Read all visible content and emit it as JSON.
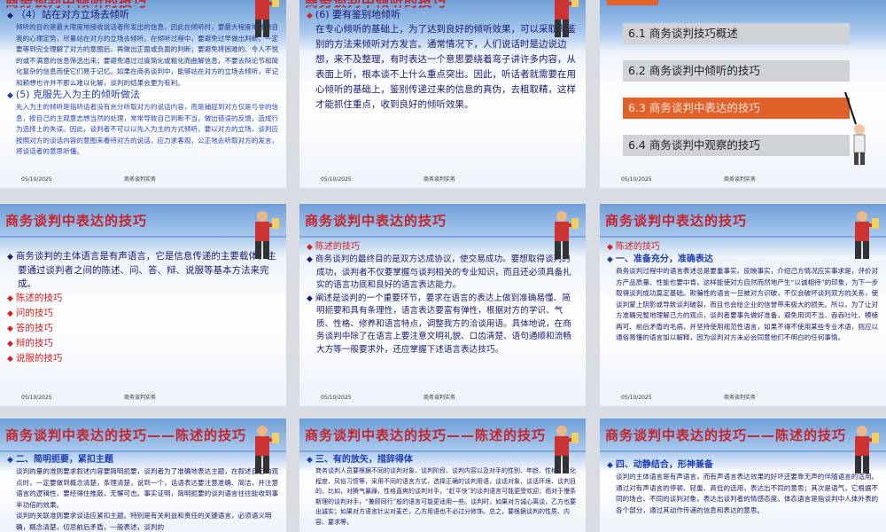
{
  "footer": {
    "date": "05/10/2025",
    "course": "商务谈判实务"
  },
  "slides": {
    "s1": {
      "title": "商务谈判中倾听的技巧",
      "h1": "（4）站在对方立场去倾听",
      "p1": "倾听的目的是最大限度地接收说话者所发出的信息，因此在倾听时，要最大程度地减除自我的心理定势，尽量站在对方的立场去倾听。在倾听过程中，要避免过早做出判断，一定要等到完全理解了对方的意图后，再做出正面或负面的判断；要避免将困难的、令人不悦的或不满意的信息筛选出来；要避免通过过度简化或粗化而曲解信息，不要去辩论节和简化复杂的信息而使它们易于记忆。如果在商务谈判中，能够站在对方的立场去倾听，牢记和赖想也许并不那么难以化解，谈判的结果会更为有利。",
      "h2": "(5) 克服先入为主的倾听做法",
      "p2": "先入为主的倾听是指听话者没有充分听取对方的说话内容，而是捕捉到对方仅是与非的信息，按自己的主观意志想当然的处理，常常导致自己判断不当，做出错误的反馈，造成行为选择上的失误。因此，谈判者不可以以先入为主的方式倾听，要以对方的立场，谈判应按照对方的谈话内容的意图来看待对方的说话，应力求客观，公正地去听取对方的发言，将谈话者的意思听懂。"
    },
    "s2": {
      "title": "商务谈判中倾听的技巧",
      "h1": "(6) 要有鉴别地倾听",
      "p1": "在专心倾听的基础上，为了达到良好的倾听效果，可以采取有鉴别的方法来倾听对方发言。通常情况下，人们说话时是边说边想，来不及整理，有时表达一个意思要绕着弯子讲许多内容，从表面上听，根本谈不上什么重点突出。因此，听话者就需要在用心倾听的基础上，鉴别传递过来的信息的真伪，去粗取精，这样才能抓住重点，收到良好的倾听效果。"
    },
    "s3": {
      "menu": [
        "6.1 商务谈判技巧概述",
        "6.2 商务谈判中倾听的技巧",
        "6.3 商务谈判中表达的技巧",
        "6.4 商务谈判中观察的技巧"
      ]
    },
    "s4": {
      "title": "商务谈判中表达的技巧",
      "p1": "商务谈判的主体语言是有声语言，它是信息传递的主要载体，主要通过谈判者之间的陈述、问、答、辩、说服等基本方法来完成。",
      "items": [
        "陈述的技巧",
        "问的技巧",
        "答的技巧",
        "辩的技巧",
        "说服的技巧"
      ]
    },
    "s5": {
      "title": "商务谈判中表达的技巧",
      "h0": "陈述的技巧",
      "p1": "商务谈判的最终目的是双方达成协议，使交易成功。要想取得谈判的成功，谈判者不仅要掌握与谈判相关的专业知识，而且还必须具备扎实的语言功底和良好的语言表达能力。",
      "p2": "阐述是谈判的一个重要环节，要求在语言的表达上做到准确易懂、简明扼要和具有条理性，语言表达要富有弹性，根据对方的学识、气质、性格、修养和语言特点，调整我方的洽谈用语。具体地说，在商务谈判中除了在语言上要注意文明礼貌、口齿清楚、语句通顺和流畅大方等一般要求外，还应掌握下述语言表达技巧。"
    },
    "s6": {
      "title": "商务谈判中表达的技巧",
      "h0": "陈述的技巧",
      "h1": "一、准备充分，准确表达",
      "p1": "商务谈判过程中的语言表述总是要重事实、反映事实，介绍己方情况应实事求是，评价对方产品质量、性能也要中肯，这样能使对方自然而然地产生“以诚相待”的印象，为下一步取得谈判成功奠定基础。欺骗性的语言一旦被对方识破，不仅会破坏谈判双方的关系，使谈判蒙上阴影或导致谈判破裂，而且也会给企业的信誉带来极大的损失。所以，为了让对方准确完整地理解己方的观点，谈判者要事先做好准备，避免用词不当、吞吞吐吐、模棱两可、前后矛盾的毛病，并坚持使用规范性语言，如果不得不使用某些专业术语，则应以通俗易懂的语言加以解释，因为谈判对方未必会同意他们不明白的任何事情。"
    },
    "s7": {
      "title": "商务谈判中表达的技巧——陈述的技巧",
      "h1": "二、简明扼要，紧扣主题",
      "p1": "谈判的量的准则要求叙述内容要简明扼要，谈判者为了准确地表达主题，在叙述自己的观点时，一定要做到概念清楚，条理清楚，说到一个，话语表达要注意准确、简洁，并注意语言的逻辑性，要经得住推敲，无懈可击。事实证明，简明扼要的谈判语言往往能收到事半功倍的效果。",
      "p2": "谈判的关联准则要求谈话应紧扣主题。特别是有关利益和责任的关键语言，必须语义明确，概念清楚，切忌前后矛盾，一般表述，谈判的"
    },
    "s8": {
      "title": "商务谈判中表达的技巧——陈述的技巧",
      "h1": "三、有的放矢，措辞得体",
      "p1": "商务谈判人员要根据不同的谈判对象、谈判阶段、谈判内容以及对手的性别、年龄、性格、文化程度、风俗习惯等，采用不同的语言方式，选择正确的谈判用语，谈话对象、谈话环境、谈判目的。比如，对腾气暴躁、性格直爽的谈判对手，“赶平快”的谈判语言可能更受欢迎；而对于慢条斯理的谈判对手，“兼顾同行”般的语言可能更适用一些。谈判时，如果对方诚心离谈，乙方也要出诚实；如果对方语言针尖对麦芒，乙方用语也不必过分修饰。总之，要根据谈判的性质、内容、要求等，"
    },
    "s9": {
      "title": "商务谈判中表达的技巧——陈述的技巧",
      "h1": "四、动静结合，形神兼备",
      "p1": "谈判的主体语言是有声语言，而有声语言表达效果的好坏还要靠无声的伴随语言的适用。通过对有声语言的停顿、轻重、高低的选用，表达出不同的意思；其次是语气，它根据不同的场合、不同的谈判对象，表达出谈判者的情感态度。体态语言是指谈判中人体外表的各个部分，通过其动作传递的信息和表达的意思。"
    }
  }
}
